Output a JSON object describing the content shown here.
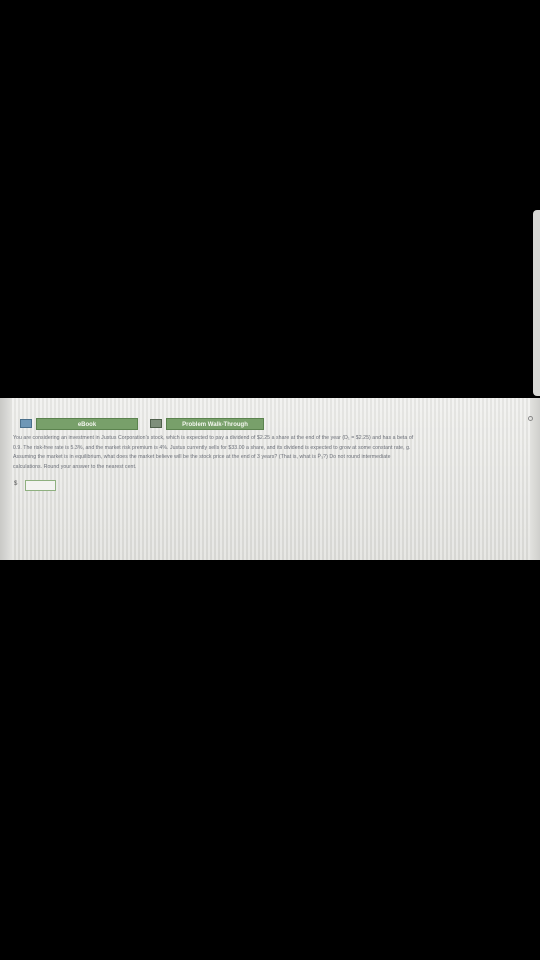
{
  "tabs": {
    "ebook_icon": "monitor-icon",
    "ebook_label": "eBook",
    "walk_icon": "document-icon",
    "walk_label": "Problem Walk-Through"
  },
  "problem": {
    "lines": [
      "You are considering an investment in Justus Corporation's stock, which is expected to pay a dividend of $2.25 a share at the end of the year (D₁ = $2.25) and has a beta of",
      "0.9. The risk-free rate is 5.3%, and the market risk premium is 4%. Justus currently sells for $33.00 a share, and its dividend is expected to grow at some constant rate, g.",
      "Assuming the market is in equilibrium, what does the market believe will be the stock price at the end of 3 years? (That is, what is P̂₃?) Do not round intermediate",
      "calculations. Round your answer to the nearest cent."
    ]
  },
  "answer": {
    "currency": "$",
    "value": ""
  },
  "colors": {
    "tab_green": "#78a06a",
    "text_gray": "#6b6f78",
    "background": "#000000"
  }
}
